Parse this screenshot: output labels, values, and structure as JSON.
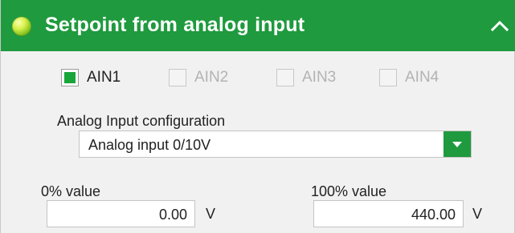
{
  "header": {
    "title": "Setpoint from analog input",
    "status_icon": "green-led-icon",
    "collapse_icon": "chevron-up-icon",
    "color": "#1f9a3e"
  },
  "inputs": [
    {
      "label": "AIN1",
      "checked": true,
      "enabled": true
    },
    {
      "label": "AIN2",
      "checked": false,
      "enabled": false
    },
    {
      "label": "AIN3",
      "checked": false,
      "enabled": false
    },
    {
      "label": "AIN4",
      "checked": false,
      "enabled": false
    }
  ],
  "config": {
    "label": "Analog Input configuration",
    "selected": "Analog input 0/10V",
    "dropdown_icon": "caret-down-icon"
  },
  "range": {
    "min": {
      "label": "0% value",
      "value": "0.00",
      "unit": "V"
    },
    "max": {
      "label": "100% value",
      "value": "440.00",
      "unit": "V"
    }
  }
}
